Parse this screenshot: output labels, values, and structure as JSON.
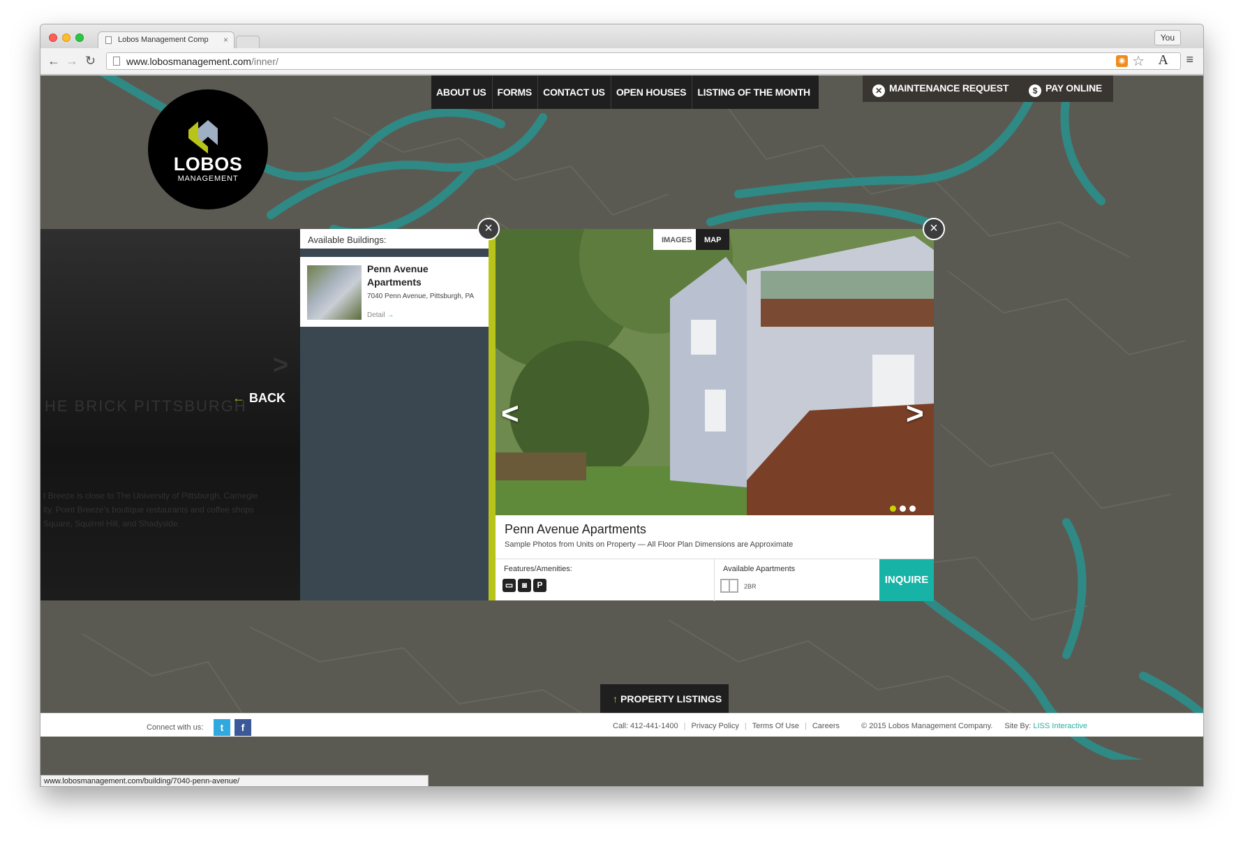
{
  "browser": {
    "tab_title": "Lobos Management Comp",
    "tab_close": "×",
    "profile": "You",
    "url_host": "www.lobosmanagement.com",
    "url_path": "/inner/",
    "status_url": "www.lobosmanagement.com/building/7040-penn-avenue/",
    "rss_glyph": "◉",
    "star_glyph": "☆",
    "font_glyph": "A",
    "menu_glyph": "≡",
    "back_glyph": "←",
    "forward_glyph": "→",
    "reload_glyph": "↻"
  },
  "nav": {
    "items": [
      "ABOUT US",
      "FORMS",
      "CONTACT US",
      "OPEN HOUSES",
      "LISTING OF THE MONTH"
    ],
    "maintenance": "MAINTENANCE REQUEST",
    "maintenance_icon": "✕",
    "pay": "PAY ONLINE",
    "pay_icon": "$"
  },
  "logo": {
    "name": "LOBOS",
    "sub": "MANAGEMENT"
  },
  "left_panel": {
    "back_label": "BACK",
    "back_arrow": "←",
    "next_glyph": ">",
    "ghost_title": "HE BRICK  PITTSBURGH",
    "ghost_text_1": "t Breeze is close to The University of Pittsburgh, Carnegie",
    "ghost_text_2": "ity, Point Breeze's boutique restaurants and coffee shops",
    "ghost_text_3": "Square, Squirrel Hill, and Shadyside."
  },
  "buildings": {
    "header": "Available Buildings:",
    "items": [
      {
        "name": "Penn Avenue Apartments",
        "address": "7040 Penn Avenue, Pittsburgh, PA",
        "detail": "Detail",
        "detail_arrow": "→"
      }
    ]
  },
  "detail": {
    "tab_images": "IMAGES",
    "tab_map": "MAP",
    "prev_glyph": "<",
    "next_glyph": ">",
    "title": "Penn Avenue Apartments",
    "subtitle": "Sample Photos from Units on Property — All Floor Plan Dimensions are Approximate",
    "features_label": "Features/Amenities:",
    "amenities": [
      "▭",
      "◙",
      "P"
    ],
    "available_label": "Available Apartments",
    "available_units": "2BR",
    "inquire": "INQUIRE",
    "close_glyph": "×"
  },
  "footer": {
    "property_listings": "PROPERTY LISTINGS",
    "property_arrow": "↑",
    "connect": "Connect with us:",
    "twitter": "t",
    "facebook": "f",
    "call": "Call: 412-441-1400",
    "privacy": "Privacy Policy",
    "terms": "Terms Of Use",
    "careers": "Careers",
    "copyright": "© 2015 Lobos Management Company.",
    "site_by": "Site By:",
    "liss": "LISS Interactive",
    "separator": "|"
  },
  "colors": {
    "accent": "#c8d400",
    "teal": "#17b3a6",
    "dark": "#1f1f1f",
    "map": "#5b5a52",
    "river": "#2f8a86"
  }
}
